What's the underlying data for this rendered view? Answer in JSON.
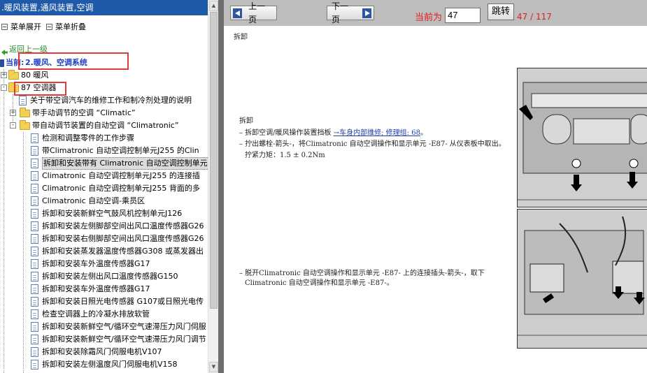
{
  "left_panel": {
    "title": ".暖风装置,通风装置,空调",
    "menu_expand": "菜单展开",
    "menu_collapse": "菜单折叠",
    "back_link": "返回上一级",
    "current_prefix": "当前:",
    "current_value": "2.暖风、空调系统",
    "tree": [
      {
        "label": "80 暖风",
        "type": "folder"
      },
      {
        "label": "87 空调器",
        "type": "folder"
      },
      {
        "label": "关于带空调汽车的维修工作和制冷剂处理的说明",
        "type": "doc"
      },
      {
        "label": "带手动调节的空调 “Climatic”",
        "type": "folder"
      },
      {
        "label": "带自动调节装置的自动空调 “Climatronic”",
        "type": "folder"
      },
      {
        "label": "检测和调整零件的工作步骤",
        "type": "doc"
      },
      {
        "label": "带Climatronic 自动空调控制单元J255 的Clin",
        "type": "doc"
      },
      {
        "label": "拆卸和安装带有 Climatronic 自动空调控制单元",
        "type": "doc"
      },
      {
        "label": "Climatronic 自动空调控制单元J255 的连接插",
        "type": "doc"
      },
      {
        "label": "Climatronic 自动空调控制单元J255 背面的多",
        "type": "doc"
      },
      {
        "label": "Climatronic 自动空调-乘员区",
        "type": "doc"
      },
      {
        "label": "拆卸和安装新鲜空气鼓风机控制单元J126",
        "type": "doc"
      },
      {
        "label": "拆卸和安装左侧脚部空间出风口温度传感器G26",
        "type": "doc"
      },
      {
        "label": "拆卸和安装右侧脚部空间出风口温度传感器G26",
        "type": "doc"
      },
      {
        "label": "拆卸和安装蒸发器温度传感器G308 或蒸发器出",
        "type": "doc"
      },
      {
        "label": "拆卸和安装车外温度传感器G17",
        "type": "doc"
      },
      {
        "label": "拆卸和安装左侧出风口温度传感器G150",
        "type": "doc"
      },
      {
        "label": "拆卸和安装车外温度传感器G17",
        "type": "doc"
      },
      {
        "label": "拆卸和安装日照光电传感器 G107或日照光电传",
        "type": "doc"
      },
      {
        "label": "检查空调器上的冷凝水排放软管",
        "type": "doc"
      },
      {
        "label": "拆卸和安装新鲜空气/循环空气速滞压力风门伺服",
        "type": "doc"
      },
      {
        "label": "拆卸和安装新鲜空气/循环空气速滞压力风门调节",
        "type": "doc"
      },
      {
        "label": "拆卸和安装除霜风门伺服电机V107",
        "type": "doc"
      },
      {
        "label": "拆卸和安装左侧温度风门伺服电机V158",
        "type": "doc"
      }
    ]
  },
  "toolbar": {
    "prev_label": "上一页",
    "next_label": "下一页",
    "current_label": "当前为",
    "page_value": "47",
    "jump_label": "跳转",
    "page_count": "47 / 117"
  },
  "document": {
    "section_heading": "拆卸",
    "sub_heading": "拆卸",
    "steps": [
      {
        "prefix": "– 拆卸空调/暖风操作装置挡板 ",
        "link": "→车身内部维修; 修理组: 68",
        "suffix": "。"
      },
      {
        "text": "– 拧出螺栓-箭头-，将Climatronic 自动空调操作和显示单元 -E87- 从仪表板中取出。"
      },
      {
        "text": "拧紧力矩：1.5 ± 0.2Nm"
      },
      {
        "text": "– 脱开Climatronic 自动空调操作和显示单元 -E87- 上的连接插头-箭头-，取下"
      },
      {
        "text": "Climatronic 自动空调操作和显示单元 -E87-。"
      }
    ]
  },
  "colors": {
    "title_bar": "#1f5aa8",
    "toolbar_bg": "#bdbdbd",
    "accent_red": "#e02020",
    "highlight_box": "#e23a3a",
    "divider": "#6e6e6e"
  }
}
